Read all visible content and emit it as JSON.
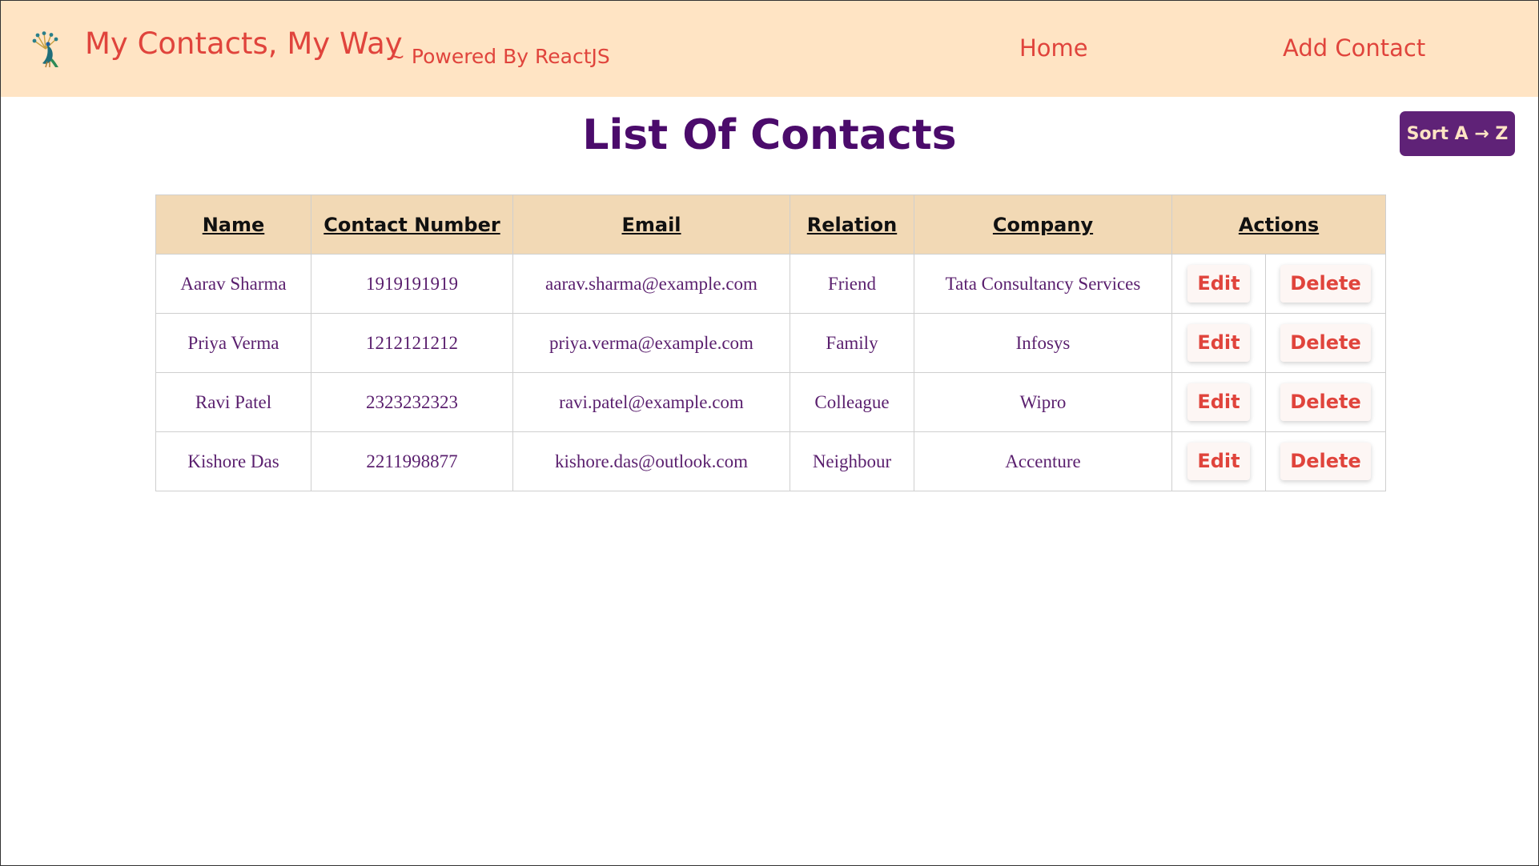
{
  "navbar": {
    "logo_icon": "peacock-icon",
    "brand_title": "My Contacts, My Way",
    "brand_subtitle": "~ Powered By ReactJS",
    "links": {
      "home": "Home",
      "add_contact": "Add Contact"
    }
  },
  "main": {
    "page_title": "List Of Contacts",
    "sort_button": "Sort A → Z"
  },
  "table": {
    "headers": {
      "name": "Name",
      "contact_number": "Contact Number",
      "email": "Email",
      "relation": "Relation",
      "company": "Company",
      "actions": "Actions"
    },
    "rows": [
      {
        "name": "Aarav Sharma",
        "contact_number": "1919191919",
        "email": "aarav.sharma@example.com",
        "relation": "Friend",
        "company": "Tata Consultancy Services"
      },
      {
        "name": "Priya Verma",
        "contact_number": "1212121212",
        "email": "priya.verma@example.com",
        "relation": "Family",
        "company": "Infosys"
      },
      {
        "name": "Ravi Patel",
        "contact_number": "2323232323",
        "email": "ravi.patel@example.com",
        "relation": "Colleague",
        "company": "Wipro"
      },
      {
        "name": "Kishore Das",
        "contact_number": "2211998877",
        "email": "kishore.das@outlook.com",
        "relation": "Neighbour",
        "company": "Accenture"
      }
    ],
    "edit_label": "Edit",
    "delete_label": "Delete"
  },
  "colors": {
    "navbar_bg": "#ffe4c4",
    "brand_red": "#e0443c",
    "title_purple": "#4b0b6b",
    "sort_button_bg": "#5f2277",
    "table_header_bg": "#f2d9b5",
    "cell_text": "#5a1f6e"
  }
}
